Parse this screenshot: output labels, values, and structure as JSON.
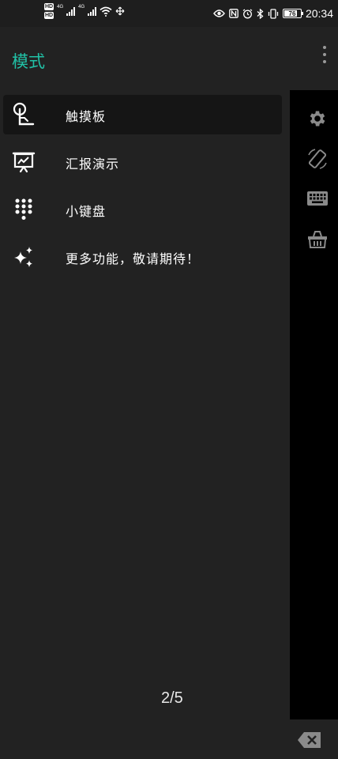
{
  "status_bar": {
    "hd1": "HD",
    "hd2": "HD",
    "net1": "4G",
    "net2": "4G",
    "battery": "76",
    "time": "20:34"
  },
  "drawer": {
    "title": "模式",
    "items": [
      {
        "label": "触摸板",
        "icon": "touchpad-icon",
        "active": true
      },
      {
        "label": "汇报演示",
        "icon": "presentation-icon",
        "active": false
      },
      {
        "label": "小键盘",
        "icon": "keypad-icon",
        "active": false
      },
      {
        "label": "更多功能，敬请期待！",
        "icon": "sparkles-icon",
        "active": false
      }
    ],
    "pager": "2/5"
  },
  "colors": {
    "accent": "#21c1a6",
    "drawer_bg": "#222222",
    "active_item_bg": "#151515",
    "side_icons": "#8a8a8a"
  },
  "side_panel_icons": [
    "more-vert-icon",
    "settings-icon",
    "screen-rotation-icon",
    "keyboard-icon",
    "basket-icon",
    "backspace-icon"
  ]
}
